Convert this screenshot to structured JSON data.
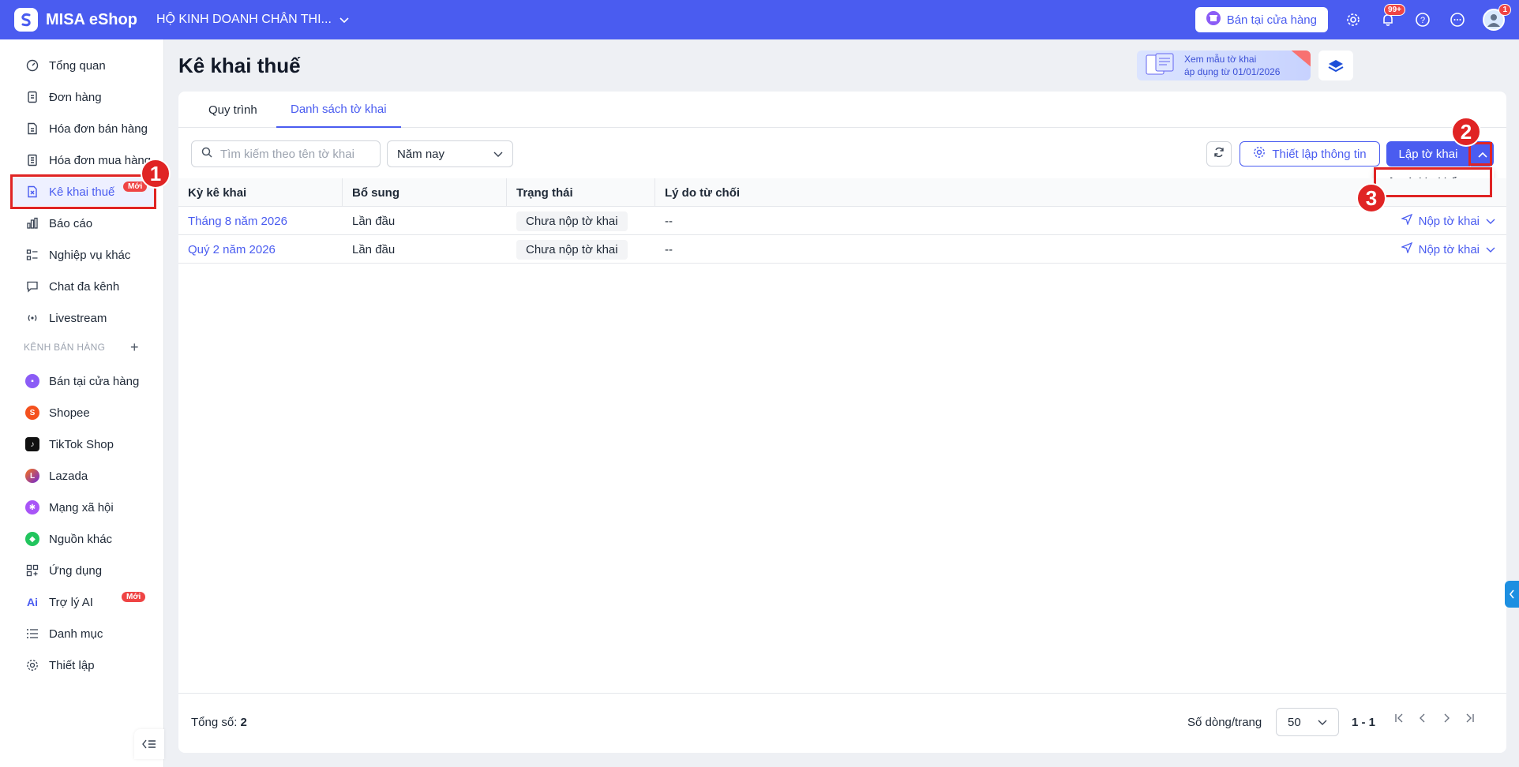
{
  "topbar": {
    "app_name": "MISA eShop",
    "store_name": "HỘ KINH DOANH CHÂN THI...",
    "sell_button": "Bán tại cửa hàng",
    "notif_badge": "99+",
    "avatar_badge": "1"
  },
  "sidebar": {
    "items": [
      {
        "label": "Tổng quan"
      },
      {
        "label": "Đơn hàng"
      },
      {
        "label": "Hóa đơn bán hàng"
      },
      {
        "label": "Hóa đơn mua hàng"
      },
      {
        "label": "Kê khai thuế",
        "badge": "Mới"
      },
      {
        "label": "Báo cáo"
      },
      {
        "label": "Nghiệp vụ khác"
      },
      {
        "label": "Chat đa kênh"
      },
      {
        "label": "Livestream"
      }
    ],
    "section_title": "KÊNH BÁN HÀNG",
    "channels": [
      {
        "label": "Bán tại cửa hàng"
      },
      {
        "label": "Shopee"
      },
      {
        "label": "TikTok Shop"
      },
      {
        "label": "Lazada"
      },
      {
        "label": "Mạng xã hội"
      },
      {
        "label": "Nguồn khác"
      },
      {
        "label": "Ứng dụng"
      },
      {
        "label": "Trợ lý AI",
        "badge": "Mới"
      },
      {
        "label": "Danh mục"
      },
      {
        "label": "Thiết lập"
      }
    ]
  },
  "page": {
    "title": "Kê khai thuế",
    "promo_line1": "Xem mẫu tờ khai",
    "promo_line2": "áp dụng từ 01/01/2026"
  },
  "tabs": [
    {
      "label": "Quy trình"
    },
    {
      "label": "Danh sách tờ khai"
    }
  ],
  "toolbar": {
    "search_placeholder": "Tìm kiếm theo tên tờ khai",
    "period": "Năm nay",
    "setup_label": "Thiết lập thông tin",
    "create_label": "Lập tờ khai",
    "dropdown_item": "Lập tờ khai bổ sung"
  },
  "table": {
    "headers": [
      "Kỳ kê khai",
      "Bổ sung",
      "Trạng thái",
      "Lý do từ chối"
    ],
    "rows": [
      {
        "period": "Tháng 8 năm 2026",
        "supplement": "Lần đầu",
        "status": "Chưa nộp tờ khai",
        "reason": "--",
        "action": "Nộp tờ khai"
      },
      {
        "period": "Quý 2 năm 2026",
        "supplement": "Lần đầu",
        "status": "Chưa nộp tờ khai",
        "reason": "--",
        "action": "Nộp tờ khai"
      }
    ]
  },
  "footer": {
    "total_label": "Tổng số:",
    "total_value": "2",
    "per_page_label": "Số dòng/trang",
    "per_page_value": "50",
    "range": "1 - 1"
  },
  "annotations": {
    "marker1": "1",
    "marker2": "2",
    "marker3": "3"
  },
  "colors": {
    "brand": "#4a5cf0",
    "annotation": "#e02424"
  }
}
